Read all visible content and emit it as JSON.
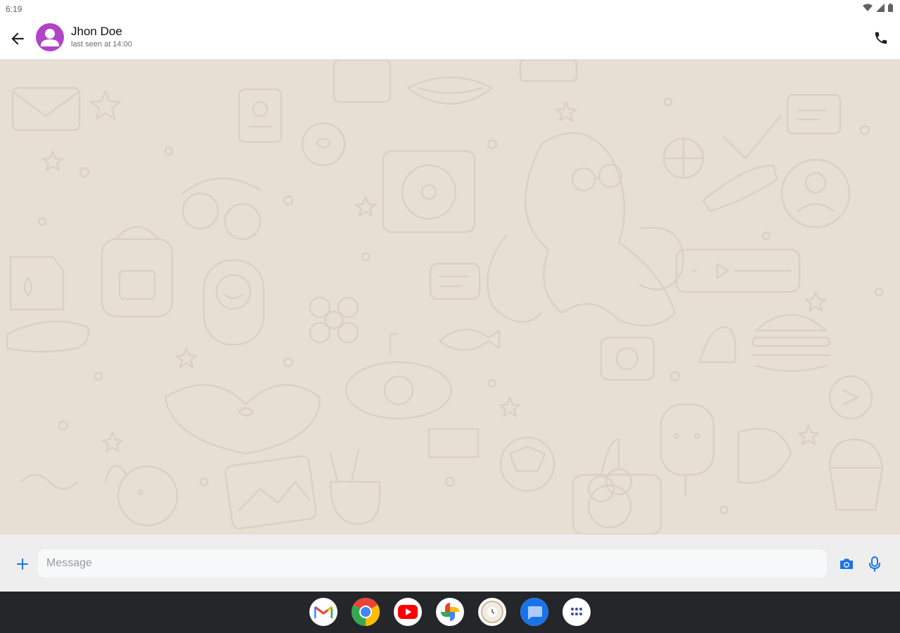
{
  "status_bar": {
    "time": "6:19",
    "icons": [
      "wifi-icon",
      "signal-icon",
      "battery-icon"
    ]
  },
  "header": {
    "contact_name": "Jhon Doe",
    "last_seen": "last seen at 14:00",
    "icons": [
      "back-arrow-icon",
      "avatar-person-icon",
      "phone-icon"
    ],
    "avatar_color": "#b043c8"
  },
  "chat": {
    "background_color": "#e7ded4",
    "wallpaper": "doodle-pattern"
  },
  "composer": {
    "placeholder": "Message",
    "value": "",
    "icons": [
      "plus-icon",
      "camera-icon",
      "mic-icon"
    ],
    "accent_color": "#1a73e8"
  },
  "taskbar": {
    "apps": [
      "gmail-icon",
      "chrome-icon",
      "youtube-icon",
      "photos-icon",
      "clock-app-icon",
      "messages-icon",
      "app-drawer-icon"
    ]
  }
}
